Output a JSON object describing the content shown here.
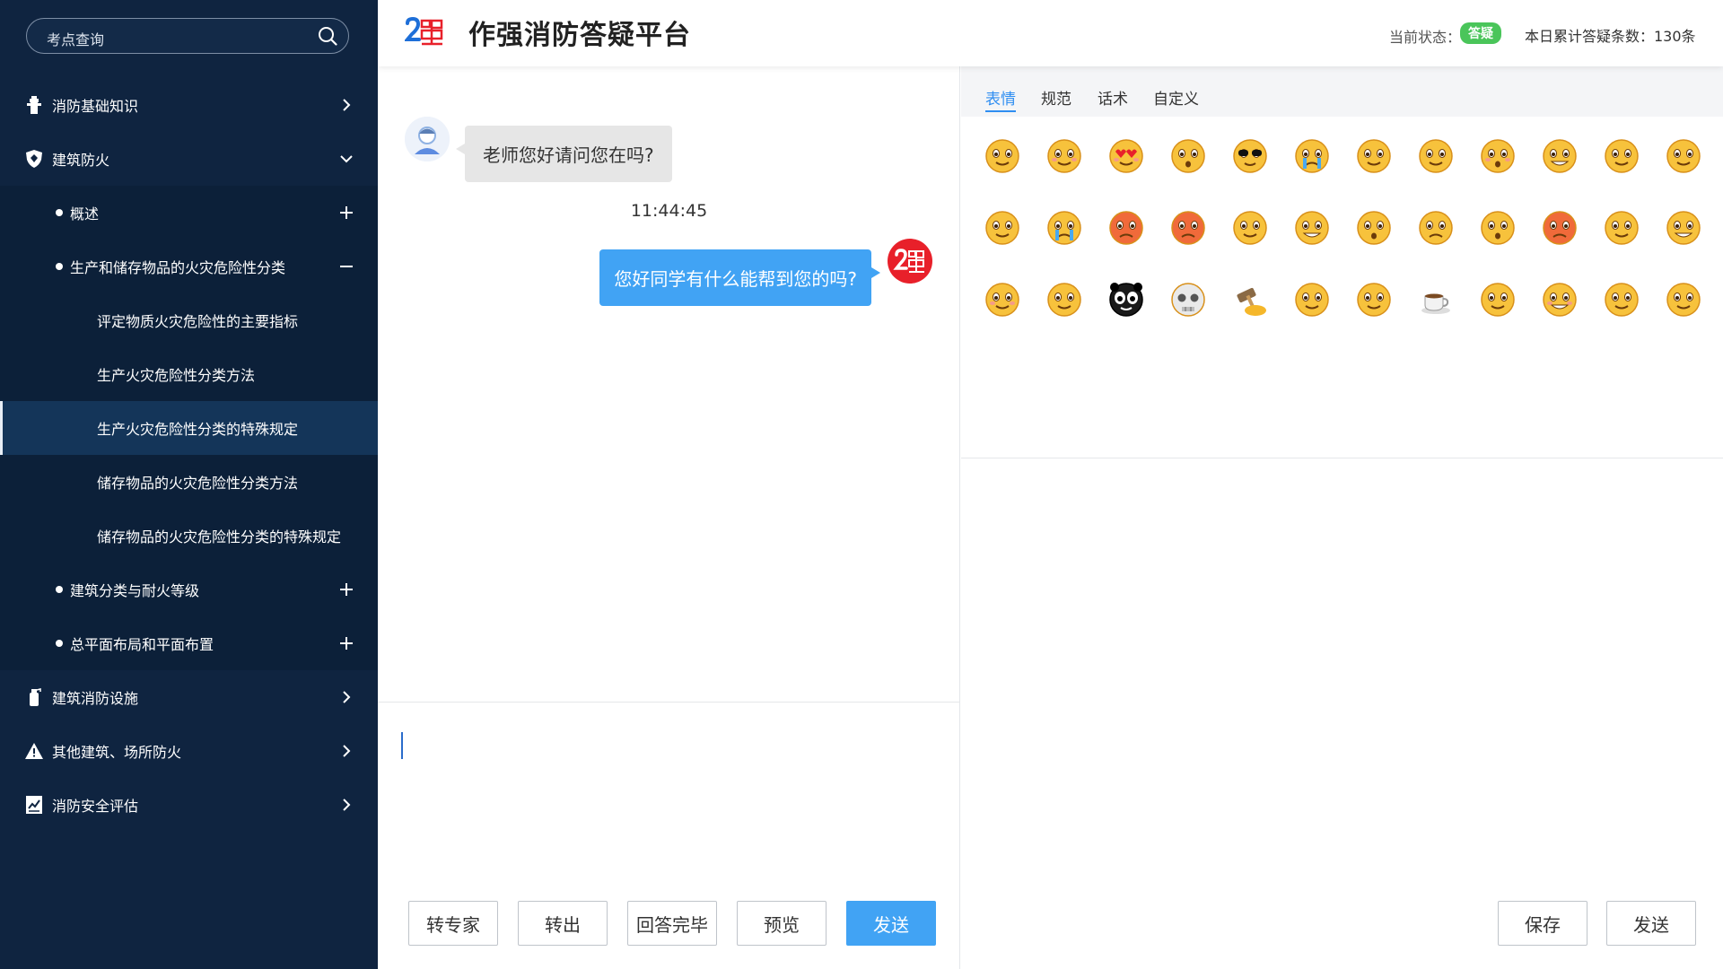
{
  "search": {
    "placeholder": "考点查询",
    "icon": "search-icon"
  },
  "sidebar": {
    "items": [
      {
        "label": "消防基础知识",
        "icon": "fire-hydrant-icon",
        "arrow": "chevron-right-icon"
      },
      {
        "label": "建筑防火",
        "icon": "shield-icon",
        "arrow": "chevron-down-icon"
      },
      {
        "label": "概述",
        "arrow": "plus-icon"
      },
      {
        "label": "生产和储存物品的火灾危险性分类",
        "arrow": "minus-icon"
      },
      {
        "label": "评定物质火灾危险性的主要指标"
      },
      {
        "label": "生产火灾危险性分类方法"
      },
      {
        "label": "生产火灾危险性分类的特殊规定"
      },
      {
        "label": "储存物品的火灾危险性分类方法"
      },
      {
        "label": "储存物品的火灾危险性分类的特殊规定"
      },
      {
        "label": "建筑分类与耐火等级",
        "arrow": "plus-icon"
      },
      {
        "label": "总平面布局和平面布置",
        "arrow": "plus-icon"
      },
      {
        "label": "建筑消防设施",
        "icon": "extinguisher-icon",
        "arrow": "chevron-right-icon"
      },
      {
        "label": "其他建筑、场所防火",
        "icon": "warning-icon",
        "arrow": "chevron-right-icon"
      },
      {
        "label": "消防安全评估",
        "icon": "report-icon",
        "arrow": "chevron-right-icon"
      }
    ],
    "active_index": 6
  },
  "header": {
    "title": "作强消防答疑平台",
    "status_label": "当前状态：",
    "status_value": "答疑",
    "count_label": "本日累计答疑条数：130条"
  },
  "chat": {
    "messages": [
      {
        "from": "user",
        "text": "老师您好请问您在吗?"
      },
      {
        "from": "teacher",
        "text": "您好同学有什么能帮到您的吗?"
      }
    ],
    "time": "11:44:45",
    "buttons": {
      "transfer_expert": "转专家",
      "transfer_out": "转出",
      "answer_done": "回答完毕",
      "preview": "预览",
      "send": "发送"
    }
  },
  "emoji_panel": {
    "tabs": [
      "表情",
      "规范",
      "话术",
      "自定义"
    ],
    "active_tab": 0,
    "emojis": [
      "smile",
      "blush",
      "heart-eyes",
      "surprised",
      "sunglasses",
      "cry",
      "smirk",
      "zipper-mouth",
      "embarrassed",
      "grimace",
      "dizzy-confused",
      "think-hand",
      "sleepy",
      "tearful",
      "sick",
      "angry",
      "tongue-wink",
      "grin",
      "gasp",
      "frown",
      "blank",
      "furious",
      "sideeye",
      "laugh",
      "shush",
      "dizzy",
      "panda",
      "skull",
      "hammer",
      "wondering",
      "smug",
      "coffee",
      "yawn",
      "giggle",
      "wink-kiss",
      "sly"
    ],
    "buttons": {
      "save": "保存",
      "send": "发送"
    }
  },
  "colors": {
    "sidebar_bg": "#0f2440",
    "accent": "#41a3f4",
    "status_green": "#4ac55a",
    "logo_red": "#e8202a"
  }
}
